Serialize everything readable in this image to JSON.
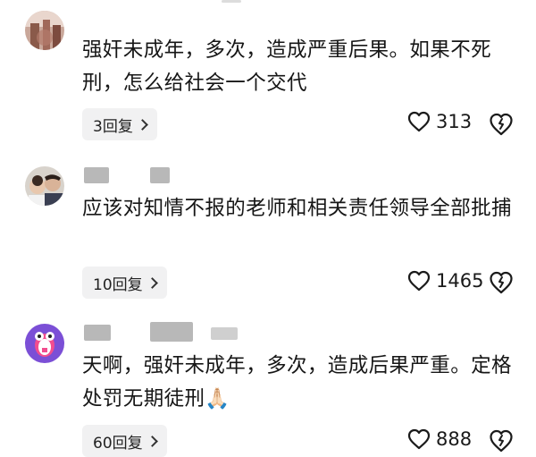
{
  "comments": [
    {
      "text": "强奸未成年，多次，造成严重后果。如果不死刑，怎么给社会一个交代",
      "reply_label": "3回复",
      "likes": "313",
      "icons": {
        "avatar": "avatar-photo",
        "like": "heart-icon",
        "dislike": "broken-heart-icon"
      }
    },
    {
      "text": "应该对知情不报的老师和相关责任领导全部批捕",
      "reply_label": "10回复",
      "likes": "1465",
      "icons": {
        "avatar": "avatar-photo",
        "like": "heart-icon",
        "dislike": "broken-heart-icon"
      }
    },
    {
      "text": "天啊，强奸未成年，多次，造成后果严重。定格处罚无期徒刑🙏🏻",
      "reply_label": "60回复",
      "likes": "888",
      "icons": {
        "avatar": "avatar-cartoon",
        "like": "heart-icon",
        "dislike": "broken-heart-icon"
      }
    }
  ],
  "colors": {
    "text": "#161616",
    "pill_bg": "#f1f1f2",
    "redacted": "#b8b8b8",
    "avatar3_bg": "#7b4fd6"
  }
}
